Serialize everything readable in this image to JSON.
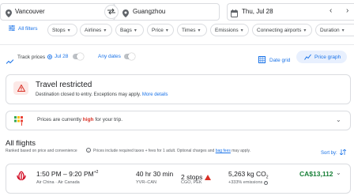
{
  "search": {
    "from": "Vancouver",
    "to": "Guangzhou",
    "date": "Thu, Jul 28"
  },
  "filters": {
    "all": "All filters",
    "chips": [
      "Stops",
      "Airlines",
      "Bags",
      "Price",
      "Times",
      "Emissions",
      "Connecting airports",
      "Duration"
    ]
  },
  "tracking": {
    "label": "Track prices",
    "date": "Jul 28",
    "any_dates": "Any dates",
    "date_grid": "Date grid",
    "price_graph": "Price graph"
  },
  "alert": {
    "title": "Travel restricted",
    "body": "Destination closed to entry. Exceptions may apply.",
    "link": "More details"
  },
  "insight": {
    "prefix": "Prices are currently ",
    "highlight": "high",
    "suffix": " for your trip."
  },
  "results": {
    "heading": "All flights",
    "ranked_note": "Ranked based on price and convenience",
    "price_note_pre": "Prices include required taxes + fees for 1 adult. Optional charges and ",
    "bag_fees": "bag fees",
    "price_note_post": " may apply.",
    "sort_label": "Sort by:",
    "flight": {
      "times": "1:50 PM – 9:20 PM",
      "day_offset": "+2",
      "airlines": "Air China · Air Canada",
      "duration": "40 hr 30 min",
      "route": "YVR–CAN",
      "stops": "2 stops",
      "stop_airports": "CGO, PEK",
      "emissions": "5,263 kg CO",
      "emissions_sub": "2",
      "emissions_delta": "+333% emissions",
      "price": "CA$13,112"
    }
  },
  "colors": {
    "accent": "#1a73e8",
    "price_high": "#d93025",
    "price_value": "#188038",
    "warning_bg": "#fce8e6"
  }
}
